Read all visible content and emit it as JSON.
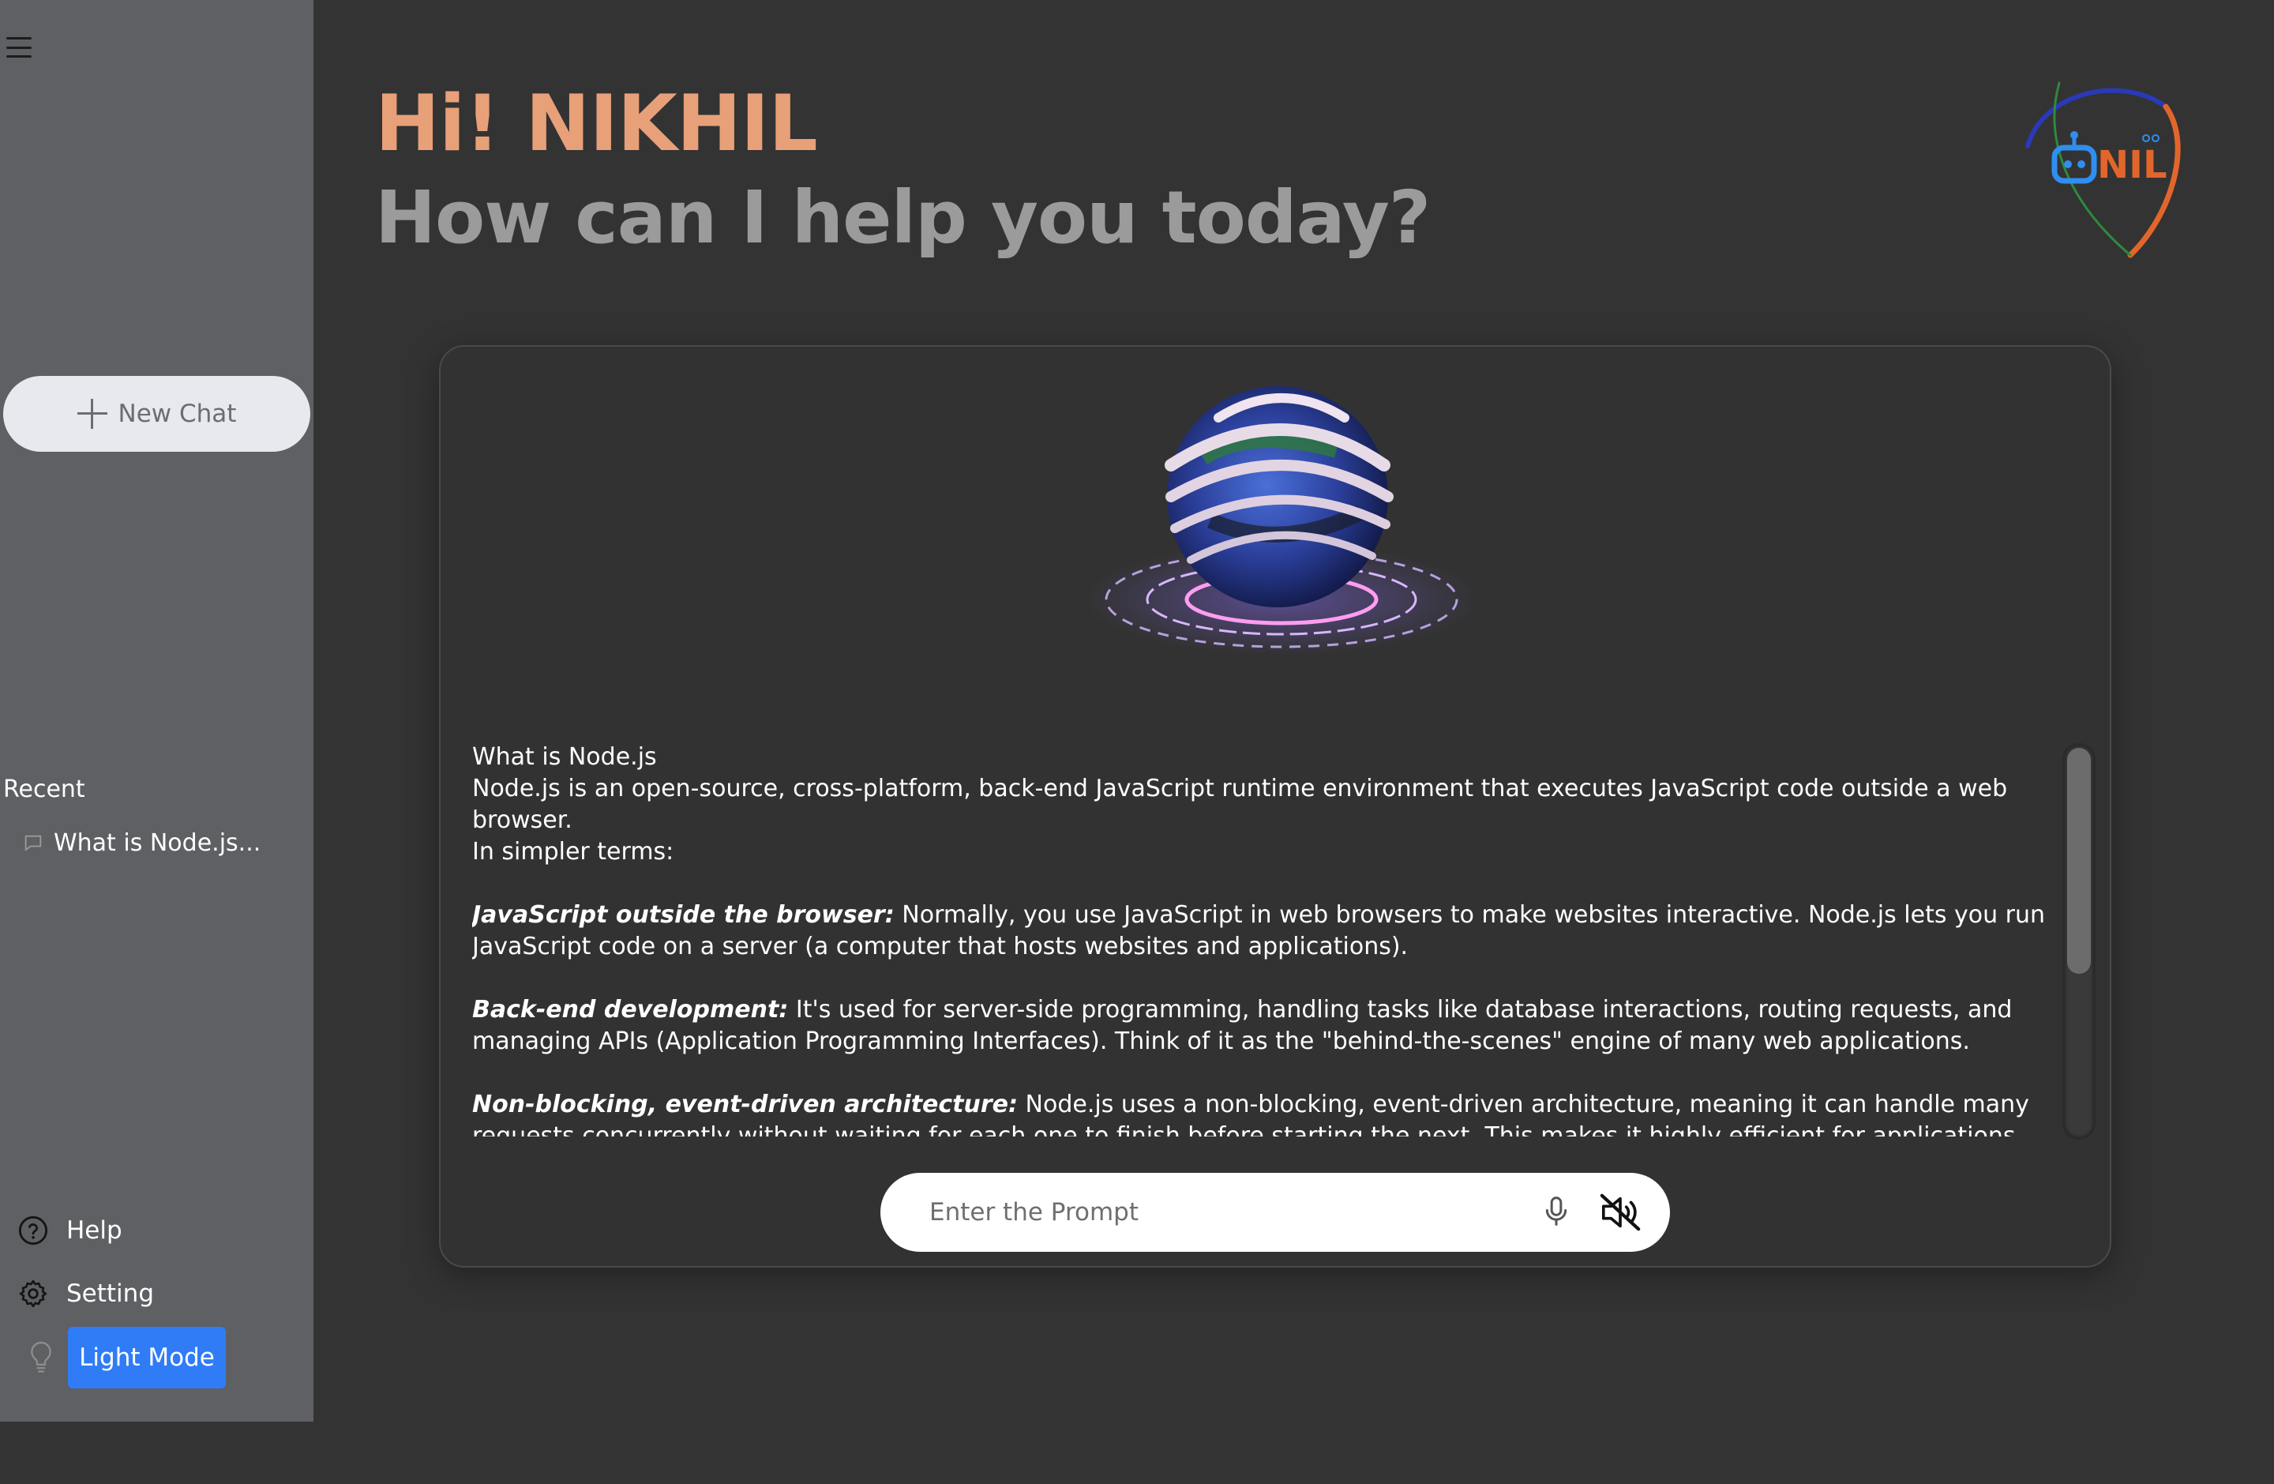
{
  "sidebar": {
    "new_chat_label": "New Chat",
    "recent_label": "Recent",
    "recent_items": [
      "What is Node.js..."
    ],
    "help_label": "Help",
    "setting_label": "Setting",
    "light_mode_label": "Light Mode"
  },
  "header": {
    "greeting": "Hi! NIKHIL",
    "subheading": "How can I help you today?",
    "logo_text": "NIL"
  },
  "chat": {
    "question": "What is Node.js",
    "intro": "Node.js is an open-source, cross-platform, back-end JavaScript runtime environment that executes JavaScript code outside a web browser.",
    "intro2": "In simpler terms:",
    "points": [
      {
        "title": "JavaScript outside the browser:",
        "text": " Normally, you use JavaScript in web browsers to make websites interactive. Node.js lets you run JavaScript code on a server (a computer that hosts websites and applications)."
      },
      {
        "title": "Back-end development:",
        "text": " It's used for server-side programming, handling tasks like database interactions, routing requests, and managing APIs (Application Programming Interfaces). Think of it as the \"behind-the-scenes\" engine of many web applications."
      },
      {
        "title": "Non-blocking, event-driven architecture:",
        "text": " Node.js uses a non-blocking, event-driven architecture, meaning it can handle many requests concurrently without waiting for each one to finish before starting the next. This makes it highly efficient for applications that need to handle a large number of concurrent connections (like chat applications or real-time updates)."
      }
    ]
  },
  "prompt": {
    "placeholder": "Enter the Prompt"
  },
  "icons": {
    "menu": "hamburger-menu-icon",
    "plus": "plus-icon",
    "chat": "chat-bubble-icon",
    "help": "question-circle-icon",
    "setting": "gear-icon",
    "bulb": "lightbulb-icon",
    "mic": "microphone-icon",
    "mute": "speaker-muted-icon"
  },
  "colors": {
    "sidebar_bg": "#5f6063",
    "main_bg": "#333333",
    "greeting": "#e8a079",
    "subheading": "#9b9b9b",
    "accent_button": "#2f7cf6"
  }
}
